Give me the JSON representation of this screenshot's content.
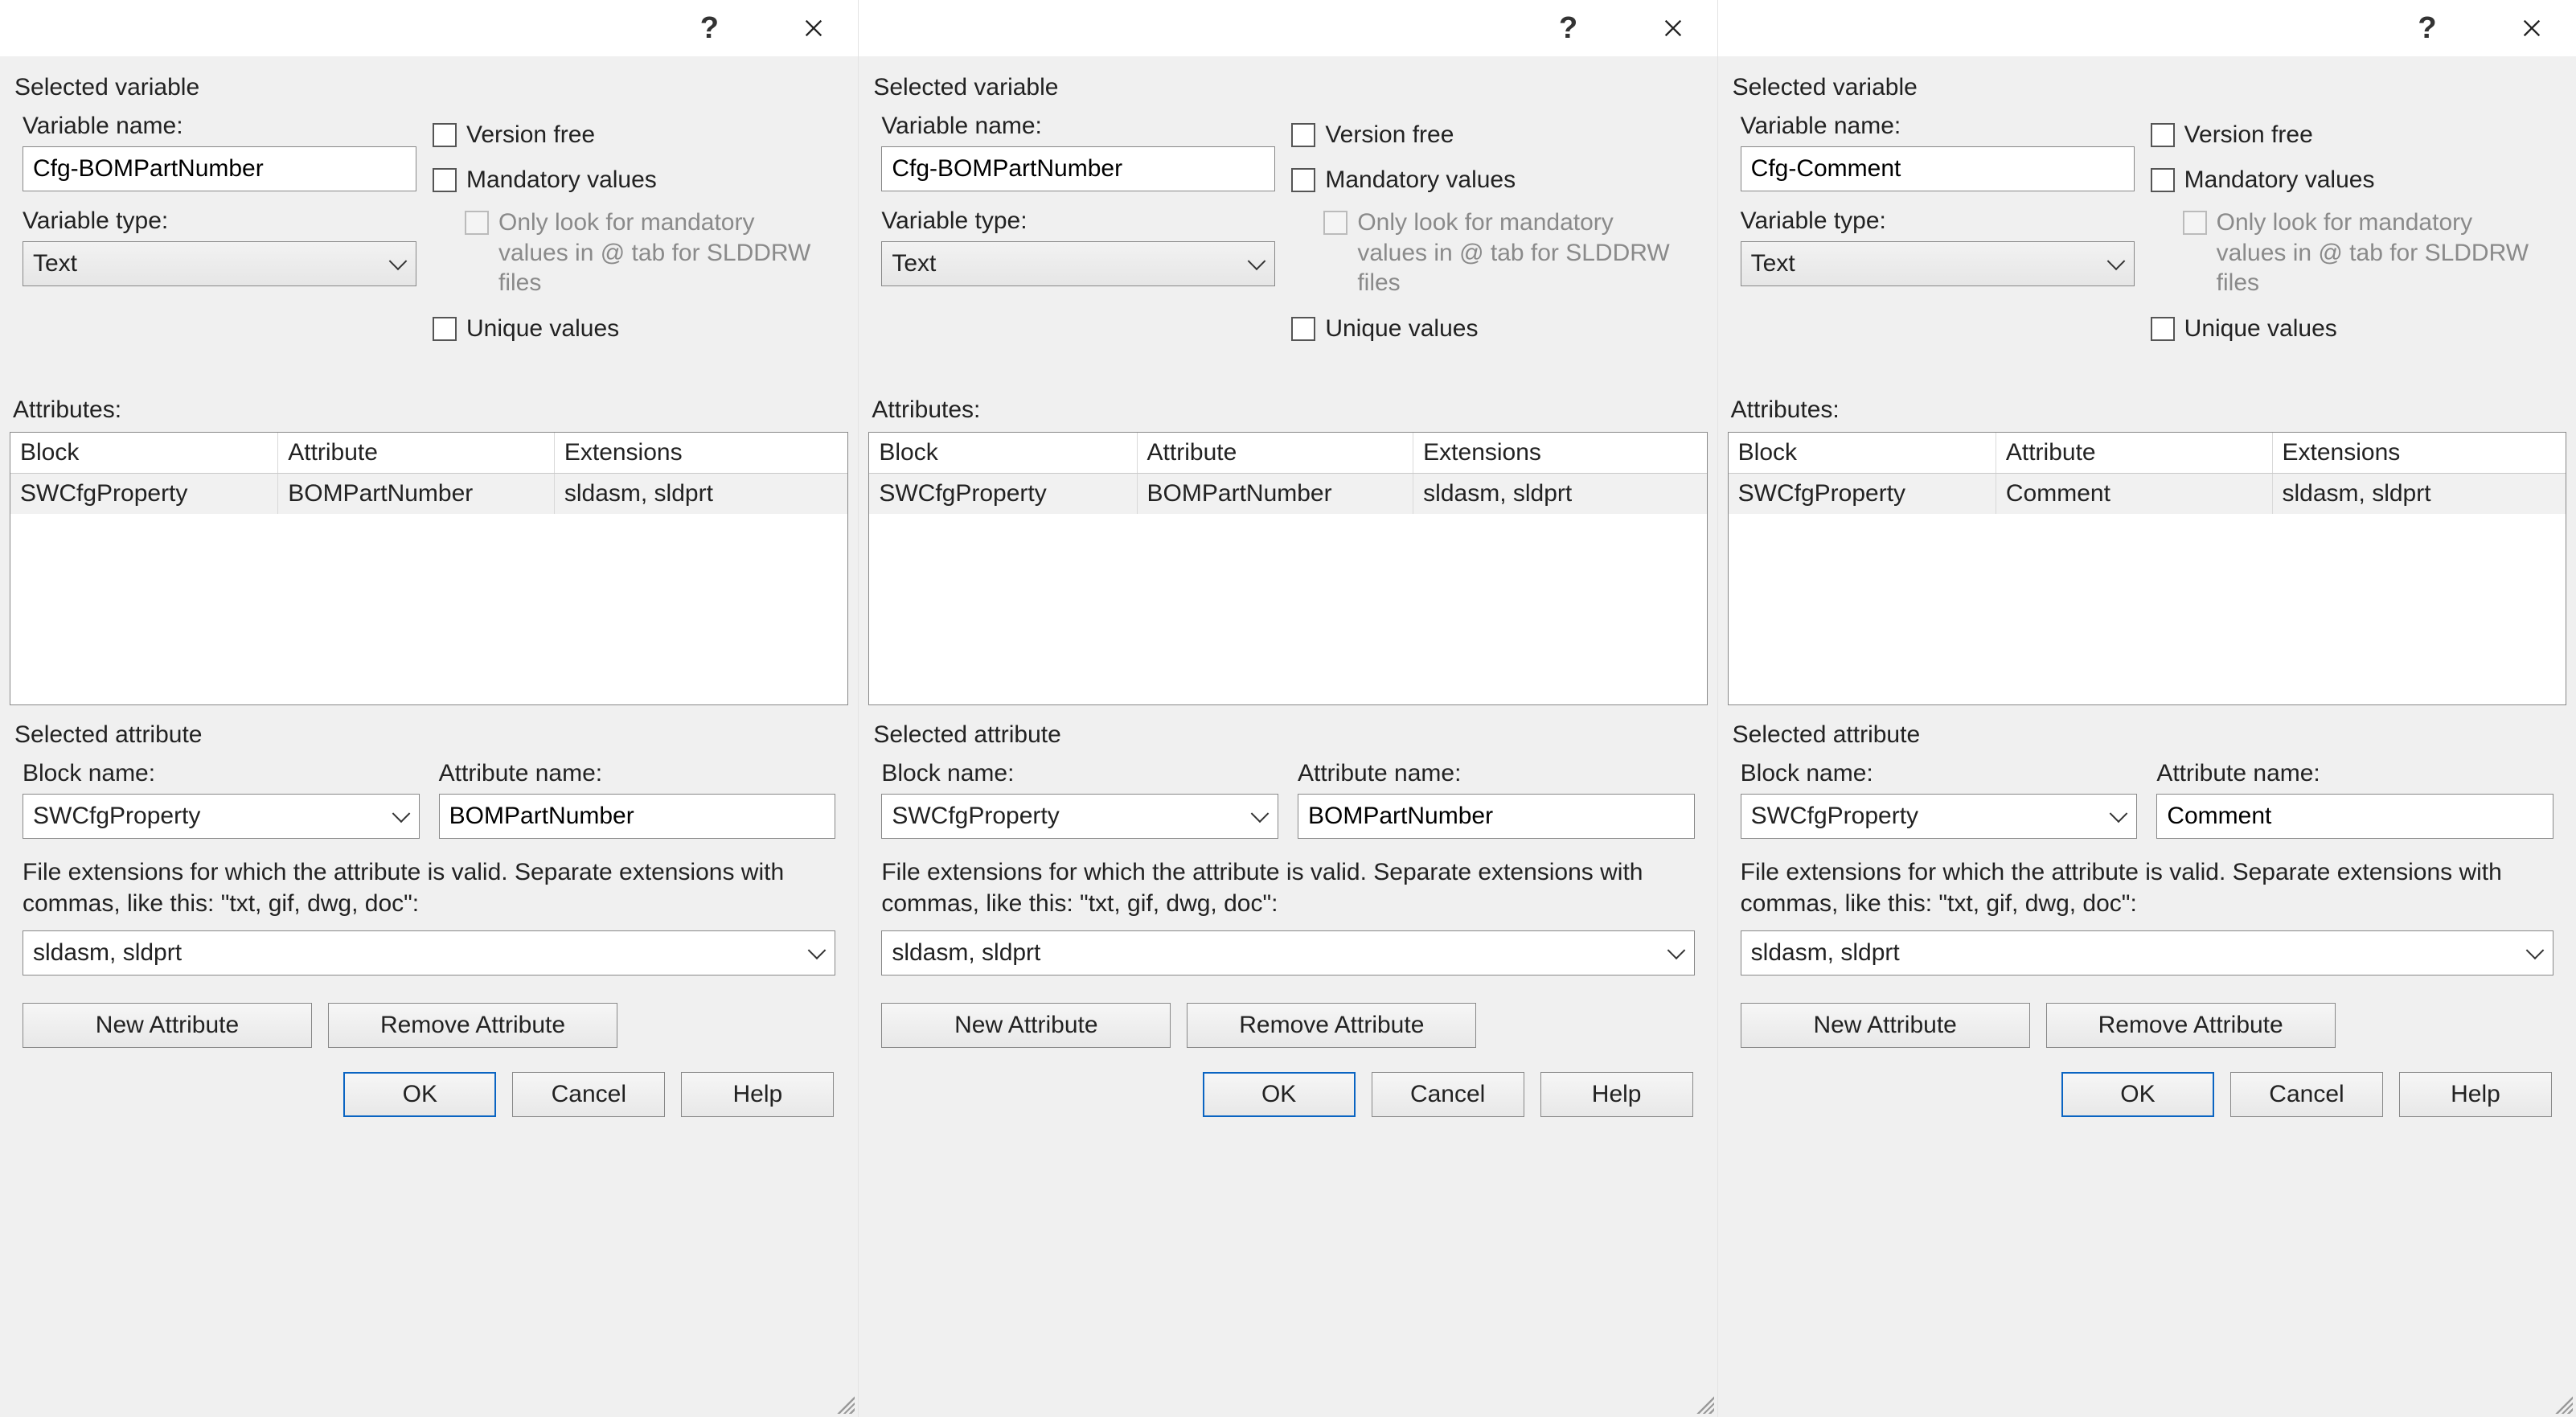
{
  "commonLabels": {
    "selectedVariable": "Selected variable",
    "variableName": "Variable name:",
    "variableType": "Variable type:",
    "versionFree": "Version free",
    "mandatoryValues": "Mandatory values",
    "onlyLookNote": "Only look for mandatory values in @ tab for SLDDRW files",
    "uniqueValues": "Unique values",
    "attributes": "Attributes:",
    "colBlock": "Block",
    "colAttribute": "Attribute",
    "colExtensions": "Extensions",
    "selectedAttribute": "Selected attribute",
    "blockName": "Block name:",
    "attributeName": "Attribute name:",
    "extHelp": "File extensions for which the attribute is valid. Separate extensions with commas, like this: \"txt, gif, dwg, doc\":",
    "newAttribute": "New Attribute",
    "removeAttribute": "Remove Attribute",
    "ok": "OK",
    "cancel": "Cancel",
    "help": "Help"
  },
  "dialogs": [
    {
      "variableName": "Cfg-BOMPartNumber",
      "variableType": "Text",
      "versionFree": false,
      "mandatoryValues": false,
      "uniqueValues": false,
      "attributeRows": [
        {
          "block": "SWCfgProperty",
          "attribute": "BOMPartNumber",
          "extensions": "sldasm, sldprt"
        }
      ],
      "selectedAttr": {
        "blockName": "SWCfgProperty",
        "attributeName": "BOMPartNumber",
        "extensions": "sldasm, sldprt"
      }
    },
    {
      "variableName": "Cfg-BOMPartNumber",
      "variableType": "Text",
      "versionFree": false,
      "mandatoryValues": false,
      "uniqueValues": false,
      "attributeRows": [
        {
          "block": "SWCfgProperty",
          "attribute": "BOMPartNumber",
          "extensions": "sldasm, sldprt"
        }
      ],
      "selectedAttr": {
        "blockName": "SWCfgProperty",
        "attributeName": "BOMPartNumber",
        "extensions": "sldasm, sldprt"
      }
    },
    {
      "variableName": "Cfg-Comment",
      "variableType": "Text",
      "versionFree": false,
      "mandatoryValues": false,
      "uniqueValues": false,
      "attributeRows": [
        {
          "block": "SWCfgProperty",
          "attribute": "Comment",
          "extensions": "sldasm, sldprt"
        }
      ],
      "selectedAttr": {
        "blockName": "SWCfgProperty",
        "attributeName": "Comment",
        "extensions": "sldasm, sldprt"
      }
    }
  ]
}
